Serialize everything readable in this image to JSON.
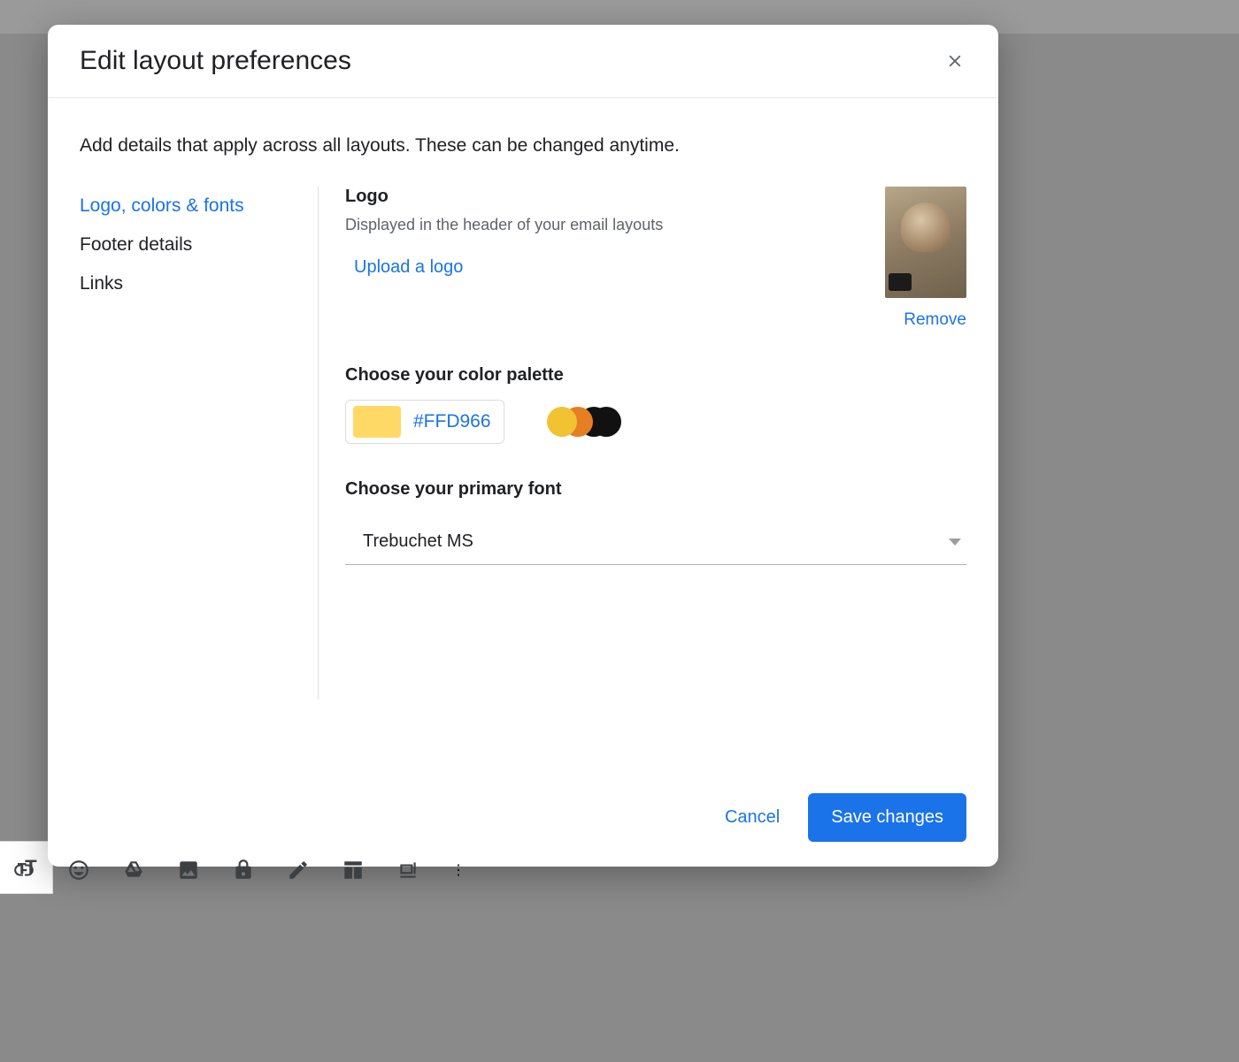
{
  "modal": {
    "title": "Edit layout preferences",
    "intro": "Add details that apply across all layouts. These can be changed anytime."
  },
  "sidebar": {
    "items": [
      {
        "label": "Logo, colors & fonts",
        "active": true
      },
      {
        "label": "Footer details",
        "active": false
      },
      {
        "label": "Links",
        "active": false
      }
    ]
  },
  "logo": {
    "heading": "Logo",
    "sub": "Displayed in the header of your email layouts",
    "upload_label": "Upload a logo",
    "remove_label": "Remove"
  },
  "palette": {
    "heading": "Choose your color palette",
    "hex": "#FFD966",
    "swatch_color": "#FFD966",
    "cluster": [
      "#f1c232",
      "#e67e22",
      "#111111",
      "#111111"
    ]
  },
  "font": {
    "heading": "Choose your primary font",
    "selected": "Trebuchet MS"
  },
  "footer": {
    "cancel": "Cancel",
    "save": "Save changes"
  },
  "bg_toolbar": {
    "text_size_icon": "тT"
  }
}
